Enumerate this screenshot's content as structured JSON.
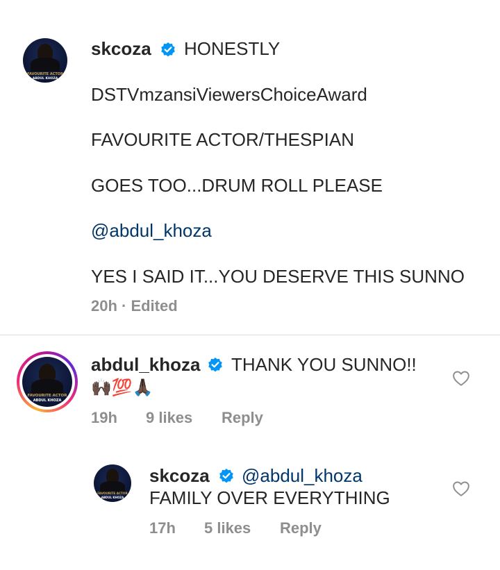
{
  "caption": {
    "username": "skcoza",
    "lines": [
      "HONESTLY",
      "DSTVmzansiViewersChoiceAward",
      "FAVOURITE ACTOR/THESPIAN",
      "GOES TOO...DRUM ROLL PLEASE",
      "@abdul_khoza",
      "YES I SAID IT...YOU DESERVE THIS SUNNO"
    ],
    "time": "20h",
    "edited": "· Edited",
    "avatar_caption_top": "FAVOURITE ACTOR",
    "avatar_caption_bottom": "ABDUL KHOZA"
  },
  "comments": [
    {
      "username": "abdul_khoza",
      "text": "THANK YOU SUNNO!!",
      "emojis": "🙌🏿💯🙏🏿",
      "time": "19h",
      "likes": "9 likes",
      "reply": "Reply",
      "avatar_caption_top": "FAVOURITE ACTOR",
      "avatar_caption_bottom": "ABDUL KHOZA"
    },
    {
      "username": "skcoza",
      "mention": "@abdul_khoza",
      "text": "FAMILY OVER EVERYTHING",
      "time": "17h",
      "likes": "5 likes",
      "reply": "Reply",
      "avatar_caption_top": "FAVOURITE ACTOR",
      "avatar_caption_bottom": "ABDUL KHOZA"
    }
  ],
  "icons": {
    "verified": "verified-badge-icon",
    "like": "heart-outline-icon"
  },
  "colors": {
    "verified_blue": "#0095f6",
    "mention_blue": "#00376b",
    "meta_gray": "#8e8e8e",
    "text": "#262626"
  }
}
